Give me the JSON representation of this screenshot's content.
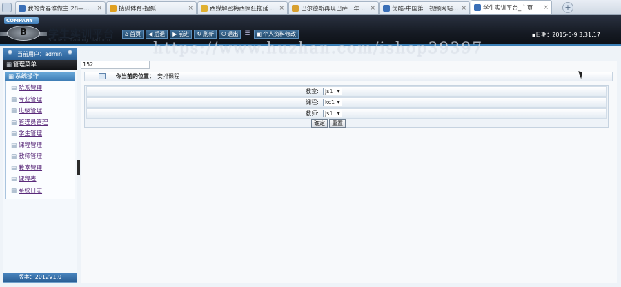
{
  "browser": {
    "tabs": [
      {
        "label": "我的青春谁做主 28—...",
        "icon_color": "#3a6fb7"
      },
      {
        "label": "搜狐体育-搜狐",
        "icon_color": "#e0a020"
      },
      {
        "label": "西媒解密梅西疯狂拖延 ...",
        "icon_color": "#e0b030"
      },
      {
        "label": "巴尔德斯再现巴萨一年 ...",
        "icon_color": "#d8a030"
      },
      {
        "label": "优酷-中国第一视频网站...",
        "icon_color": "#3a6fb7"
      },
      {
        "label": "学生实训平台_主页",
        "icon_color": "#3a6fb7",
        "active": true
      }
    ],
    "newtab_label": "+"
  },
  "header": {
    "company": "COMPANY",
    "logo_letter": "B",
    "brand": "学生实训平台",
    "brand_sub": "Student Training platform",
    "nav": [
      {
        "label": "首页",
        "icon": "home-icon",
        "glyph": "⌂"
      },
      {
        "label": "后退",
        "icon": "back-icon",
        "glyph": "◀"
      },
      {
        "label": "前进",
        "icon": "forward-icon",
        "glyph": "▶"
      },
      {
        "label": "刷新",
        "icon": "refresh-icon",
        "glyph": "↻"
      },
      {
        "label": "退出",
        "icon": "power-icon",
        "glyph": "⏻"
      }
    ],
    "personal_btn": "个人资料修改",
    "date_label": "日期：2015-5-9 3:31:17"
  },
  "watermark": "https://www.huzhan.com/ishop39397",
  "sidebar": {
    "current_user": "当前用户：admin",
    "menu_title": "管理菜单",
    "section_title": "系统操作",
    "items": [
      {
        "label": "院系管理"
      },
      {
        "label": "专业管理"
      },
      {
        "label": "班级管理"
      },
      {
        "label": "管理员管理"
      },
      {
        "label": "学生管理"
      },
      {
        "label": "课程管理"
      },
      {
        "label": "教师管理"
      },
      {
        "label": "教室管理"
      },
      {
        "label": "课程表"
      },
      {
        "label": "系统日志"
      }
    ],
    "version": "版本：2012V1.0"
  },
  "main": {
    "counter": "152",
    "location_label": "你当前的位置：",
    "location_value": "安排课程",
    "form": {
      "classroom_label": "教室:",
      "classroom_value": "js1",
      "course_label": "课程:",
      "course_value": "kc1",
      "teacher_label": "教师:",
      "teacher_value": "js1",
      "confirm": "确定",
      "reset": "重置"
    }
  }
}
